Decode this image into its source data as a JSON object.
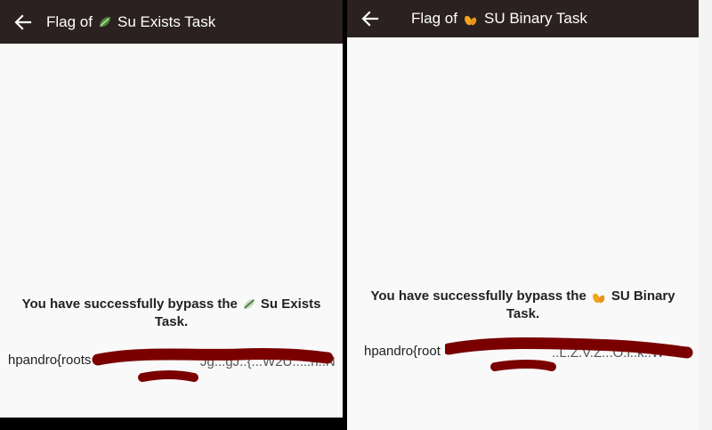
{
  "left": {
    "title_prefix": "Flag of",
    "title_suffix": "Su Exists Task",
    "icon": "leaf-icon",
    "message_prefix": "You have successfully bypass the",
    "message_suffix": "Su Exists",
    "message_line2": "Task.",
    "flag_text": "hpandro{roots"
  },
  "right": {
    "title_prefix": "Flag of",
    "title_suffix": "SU Binary Task",
    "icon": "beans-icon",
    "message_prefix": "You have successfully bypass the",
    "message_suffix": "SU Binary",
    "message_line2": "Task.",
    "flag_text": "hpandro{root"
  },
  "colors": {
    "appbar": "#2a2120",
    "redaction": "#7a0000",
    "leaf": "#4c8a3a",
    "beans": "#f4a31d"
  }
}
